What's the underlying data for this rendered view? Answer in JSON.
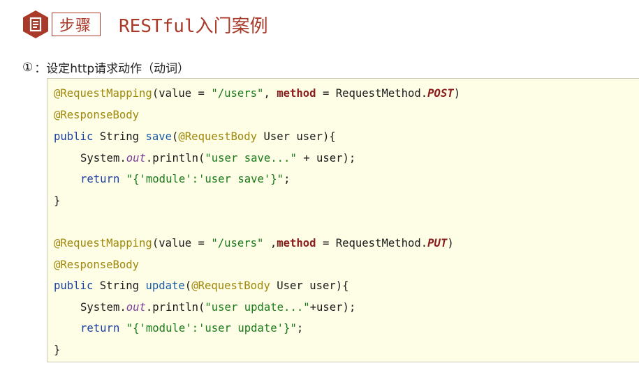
{
  "header": {
    "step_label": "步骤",
    "title": "RESTful入门案例",
    "badge_icon": "document-icon",
    "accent_color": "#a93a2a"
  },
  "step": {
    "number": "①",
    "text": "：设定http请求动作（动词）"
  },
  "code": {
    "background": "#fefde6",
    "lines": {
      "l1": {
        "a": "@RequestMapping",
        "b": "(value = ",
        "c": "\"/users\"",
        "d": ", ",
        "e": "method",
        "f": " = RequestMethod.",
        "g": "POST",
        "h": ")"
      },
      "l2": {
        "a": "@ResponseBody"
      },
      "l3": {
        "a": "public",
        "b": " String ",
        "c": "save",
        "d": "(",
        "e": "@RequestBody",
        "f": " User user){"
      },
      "l4": {
        "a": "System.",
        "b": "out",
        "c": ".println(",
        "d": "\"user save...\"",
        "e": " + user);"
      },
      "l5": {
        "a": "return",
        "b": " ",
        "c": "\"{'module':'user save'}\"",
        "d": ";"
      },
      "l6": {
        "a": "}"
      },
      "l7": {
        "a": "@RequestMapping",
        "b": "(value = ",
        "c": "\"/users\"",
        "d": " ,",
        "e": "method",
        "f": " = RequestMethod.",
        "g": "PUT",
        "h": ")"
      },
      "l8": {
        "a": "@ResponseBody"
      },
      "l9": {
        "a": "public",
        "b": " String ",
        "c": "update",
        "d": "(",
        "e": "@RequestBody",
        "f": " User user){"
      },
      "l10": {
        "a": "System.",
        "b": "out",
        "c": ".println(",
        "d": "\"user update...\"",
        "e": "+user);"
      },
      "l11": {
        "a": "return",
        "b": " ",
        "c": "\"{'module':'user update'}\"",
        "d": ";"
      },
      "l12": {
        "a": "}"
      }
    }
  }
}
